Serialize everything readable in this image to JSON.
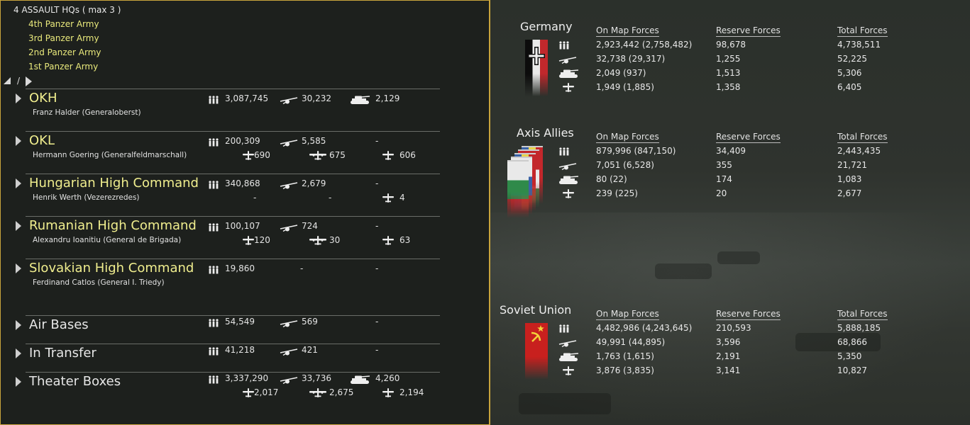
{
  "hq": {
    "title": "4 ASSAULT HQs ( max 3 )",
    "items": [
      "4th Panzer Army",
      "3rd Panzer Army",
      "2nd Panzer Army",
      "1st Panzer Army"
    ]
  },
  "nav": {
    "separator": "/"
  },
  "commands": {
    "okh": {
      "name": "OKH",
      "leader": "Franz Halder  (Generaloberst)",
      "men": "3,087,745",
      "guns": "30,232",
      "afv": "2,129"
    },
    "okl": {
      "name": "OKL",
      "leader": "Hermann Goering  (Generalfeldmarschall)",
      "men": "200,309",
      "guns": "5,585",
      "afv": "-",
      "fighter": "690",
      "bomber": "675",
      "other": "606"
    },
    "hungary": {
      "name": "Hungarian High Command",
      "leader": "Henrik Werth  (Vezerezredes)",
      "men": "340,868",
      "guns": "2,679",
      "afv": "-",
      "fighter": "-",
      "bomber": "-",
      "other": "4"
    },
    "romania": {
      "name": "Rumanian High Command",
      "leader": "Alexandru Ioanitiu  (General de Brigada)",
      "men": "100,107",
      "guns": "724",
      "afv": "-",
      "fighter": "120",
      "bomber": "30",
      "other": "63"
    },
    "slovakia": {
      "name": "Slovakian High Command",
      "leader": "Ferdinand Catlos  (General I. Triedy)",
      "men": "19,860",
      "guns": "-",
      "afv": "-"
    },
    "airbases": {
      "name": "Air Bases",
      "men": "54,549",
      "guns": "569",
      "afv": "-"
    },
    "transfer": {
      "name": "In Transfer",
      "men": "41,218",
      "guns": "421",
      "afv": "-"
    },
    "theater": {
      "name": "Theater Boxes",
      "men": "3,337,290",
      "guns": "33,736",
      "afv": "4,260",
      "fighter": "2,017",
      "bomber": "2,675",
      "other": "2,194"
    }
  },
  "columns": {
    "onmap": "On Map Forces",
    "reserve": "Reserve Forces",
    "total": "Total Forces"
  },
  "nations": {
    "germany": {
      "name": "Germany",
      "rows": [
        {
          "onmap": "2,923,442 (2,758,482)",
          "reserve": "98,678",
          "total": "4,738,511"
        },
        {
          "onmap": "32,738 (29,317)",
          "reserve": "1,255",
          "total": "52,225"
        },
        {
          "onmap": "2,049 (937)",
          "reserve": "1,513",
          "total": "5,306"
        },
        {
          "onmap": "1,949 (1,885)",
          "reserve": "1,358",
          "total": "6,405"
        }
      ]
    },
    "axis": {
      "name": "Axis Allies",
      "rows": [
        {
          "onmap": "879,996 (847,150)",
          "reserve": "34,409",
          "total": "2,443,435"
        },
        {
          "onmap": "7,051 (6,528)",
          "reserve": "355",
          "total": "21,721"
        },
        {
          "onmap": "80 (22)",
          "reserve": "174",
          "total": "1,083"
        },
        {
          "onmap": "239 (225)",
          "reserve": "20",
          "total": "2,677"
        }
      ]
    },
    "soviet": {
      "name": "Soviet Union",
      "rows": [
        {
          "onmap": "4,482,986 (4,243,645)",
          "reserve": "210,593",
          "total": "5,888,185"
        },
        {
          "onmap": "49,991 (44,895)",
          "reserve": "3,596",
          "total": "68,866"
        },
        {
          "onmap": "1,763 (1,615)",
          "reserve": "2,191",
          "total": "5,350"
        },
        {
          "onmap": "3,876 (3,835)",
          "reserve": "3,141",
          "total": "10,827"
        }
      ]
    }
  },
  "icons": [
    "men-icon",
    "gun-icon",
    "tank-icon",
    "fighter-plane-icon",
    "bomber-plane-icon",
    "plane-icon"
  ],
  "colors": {
    "accent_border": "#c9a43c",
    "command_name": "#f0ee8e",
    "hq_item": "#eaea7c"
  }
}
